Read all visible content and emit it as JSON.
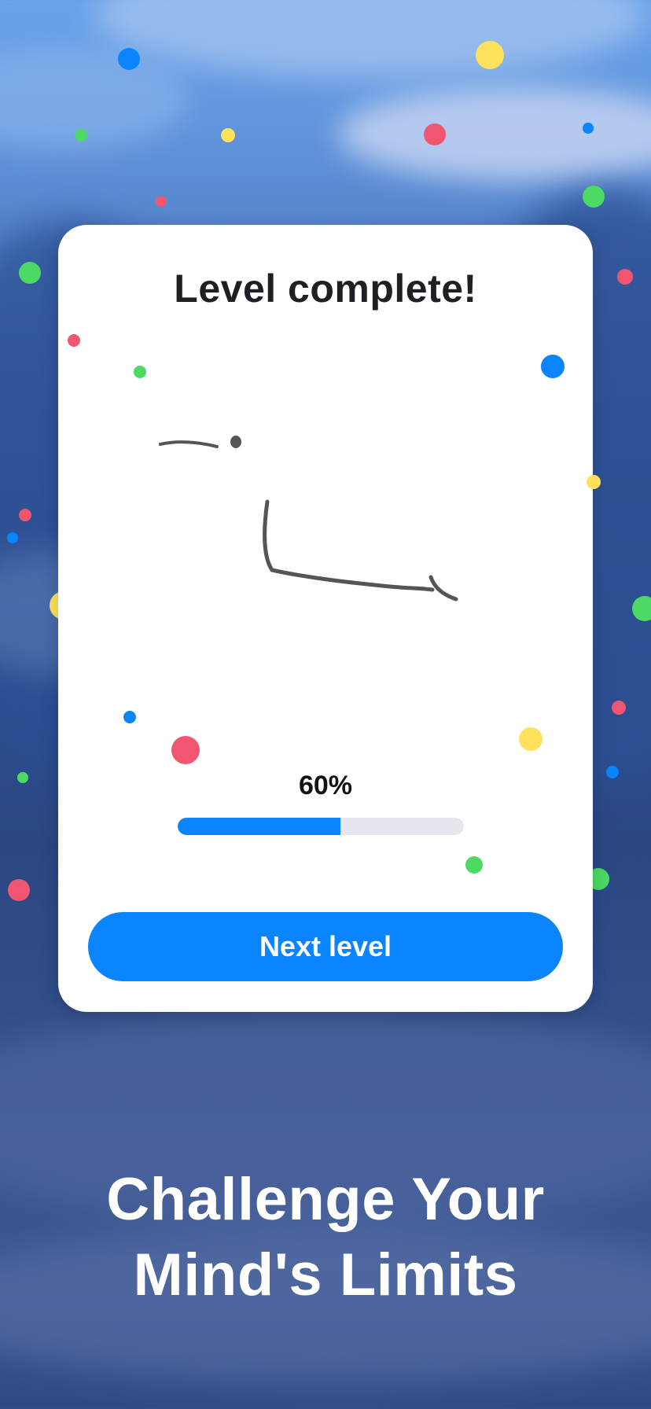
{
  "card": {
    "title": "Level complete!",
    "progress_percent_label": "60%",
    "progress_value": 0.57,
    "next_button_label": "Next level"
  },
  "tagline": {
    "line1": "Challenge Your",
    "line2": "Mind's Limits"
  },
  "icons": {
    "bird": "crow-icon"
  },
  "colors": {
    "accent": "#0a84ff",
    "progress_track": "#e7e6ef",
    "bird_fill": "#9d9aae",
    "bird_stroke": "#555558",
    "confetti": [
      "#0a84ff",
      "#ffe15c",
      "#f0566f",
      "#4cd964"
    ]
  }
}
